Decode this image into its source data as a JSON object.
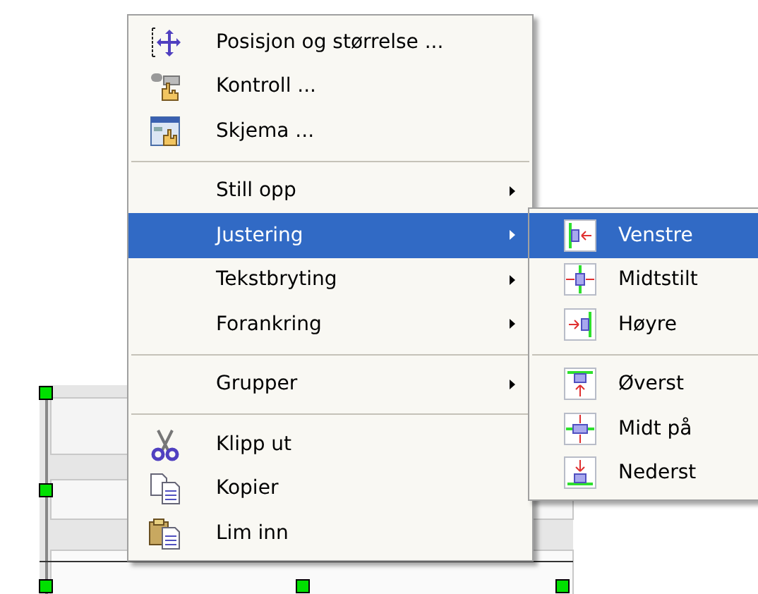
{
  "context_menu": {
    "items": [
      {
        "kind": "item",
        "label": "Posisjon og størrelse ...",
        "submenu": false,
        "selected": false
      },
      {
        "kind": "item",
        "label": "Kontroll ...",
        "submenu": false,
        "selected": false
      },
      {
        "kind": "item",
        "label": "Skjema ...",
        "submenu": false,
        "selected": false
      },
      {
        "kind": "separator"
      },
      {
        "kind": "item",
        "label": "Still opp",
        "submenu": true,
        "selected": false
      },
      {
        "kind": "item",
        "label": "Justering",
        "submenu": true,
        "selected": true
      },
      {
        "kind": "item",
        "label": "Tekstbryting",
        "submenu": true,
        "selected": false
      },
      {
        "kind": "item",
        "label": "Forankring",
        "submenu": true,
        "selected": false
      },
      {
        "kind": "separator"
      },
      {
        "kind": "item",
        "label": "Grupper",
        "submenu": true,
        "selected": false
      },
      {
        "kind": "separator"
      },
      {
        "kind": "item",
        "label": "Klipp ut",
        "submenu": false,
        "selected": false
      },
      {
        "kind": "item",
        "label": "Kopier",
        "submenu": false,
        "selected": false
      },
      {
        "kind": "item",
        "label": "Lim inn",
        "submenu": false,
        "selected": false
      }
    ]
  },
  "submenu": {
    "items": [
      {
        "kind": "item",
        "label": "Venstre",
        "selected": true
      },
      {
        "kind": "item",
        "label": "Midtstilt",
        "selected": false
      },
      {
        "kind": "item",
        "label": "Høyre",
        "selected": false
      },
      {
        "kind": "separator"
      },
      {
        "kind": "item",
        "label": "Øverst",
        "selected": false
      },
      {
        "kind": "item",
        "label": "Midt på",
        "selected": false
      },
      {
        "kind": "item",
        "label": "Nederst",
        "selected": false
      }
    ]
  }
}
